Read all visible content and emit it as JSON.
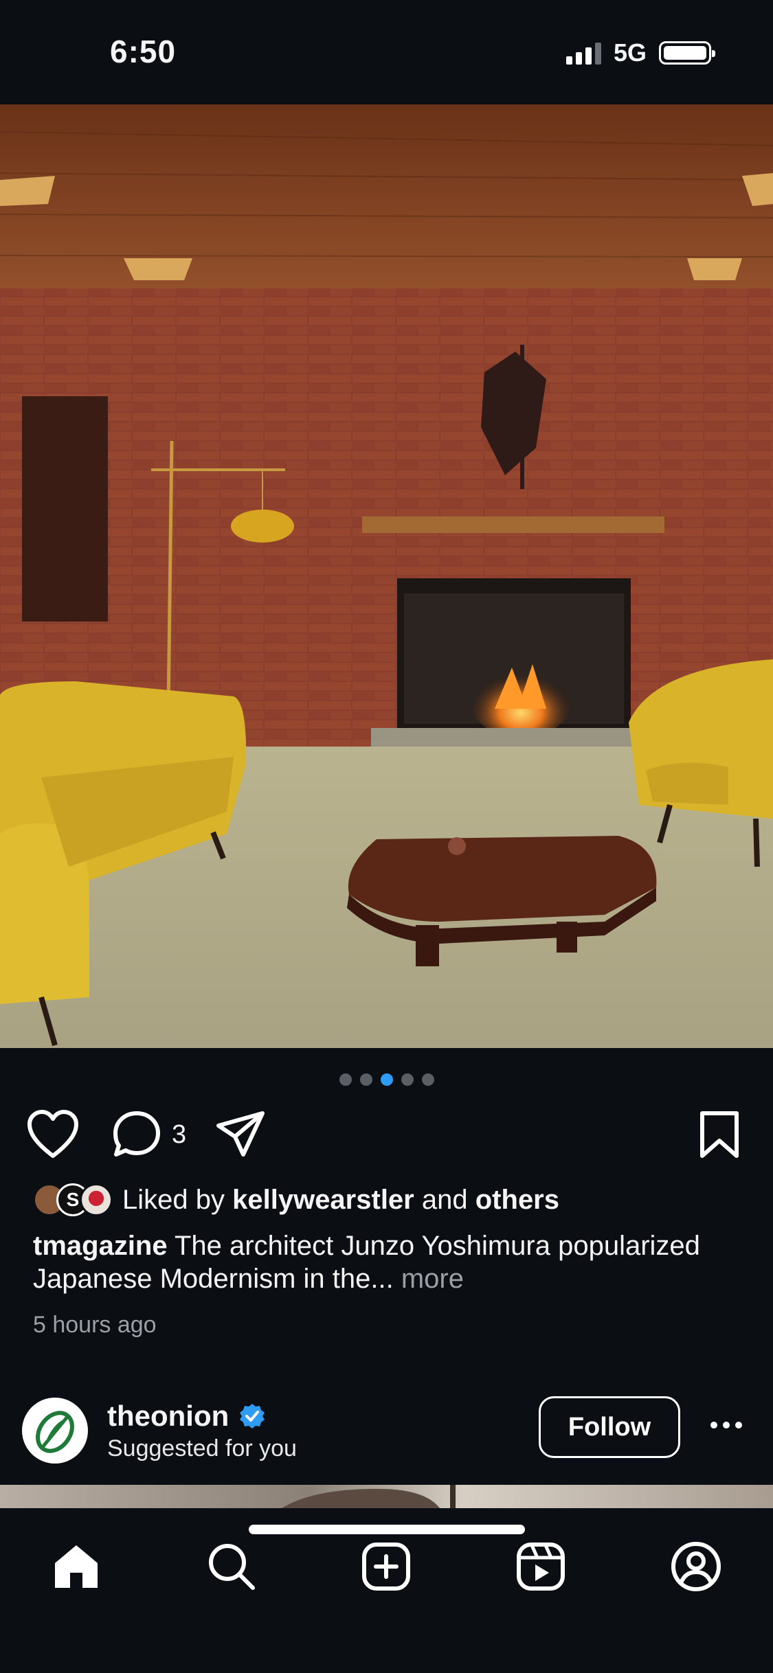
{
  "status": {
    "time": "6:50",
    "network": "5G"
  },
  "carousel": {
    "count": 5,
    "active_index": 2
  },
  "actions": {
    "comment_count": "3"
  },
  "likes": {
    "prefix": "Liked by",
    "user": "kellywearstler",
    "joiner": "and",
    "others": "others",
    "avatar_letter": "S"
  },
  "caption": {
    "username": "tmagazine",
    "text": "The architect Junzo Yoshimura popularized Japanese Modernism in the...",
    "more": "more"
  },
  "timestamp": "5 hours ago",
  "suggested": {
    "username": "theonion",
    "verified": true,
    "subtitle": "Suggested for you",
    "follow_label": "Follow"
  },
  "tabs": [
    "home-icon",
    "search-icon",
    "create-icon",
    "reels-icon",
    "profile-icon"
  ],
  "colors": {
    "background": "#0b0f14",
    "accent": "#2e9bf5",
    "onion_green": "#1f7a3a"
  }
}
